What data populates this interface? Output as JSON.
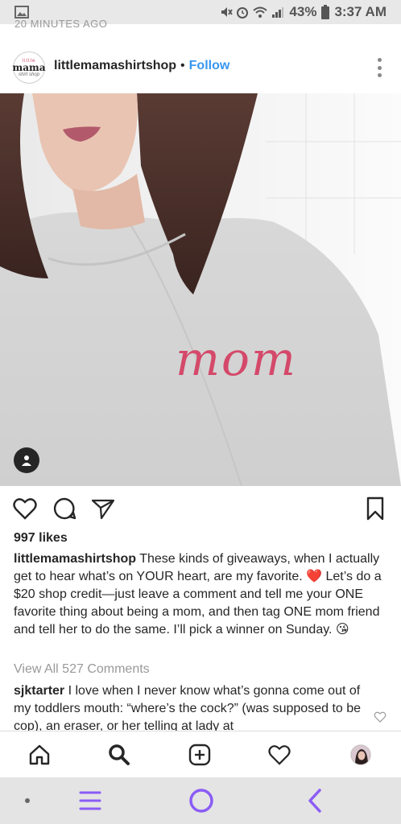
{
  "status_bar": {
    "battery": "43%",
    "time": "3:37 AM"
  },
  "post": {
    "time_partial": "20 MINUTES AGO",
    "logo_text": [
      "little",
      "mama",
      "shirt shop"
    ],
    "username": "littlemamashirtshop",
    "separator": "•",
    "follow_label": "Follow",
    "likes": "997 likes",
    "caption_user": "littlemamashirtshop",
    "caption_text": "These kinds of giveaways, when I actually get to hear what’s on YOUR heart, are my favorite. ❤️ Let’s do a $20 shop credit—just leave a comment and tell me your ONE favorite thing about being a mom, and then tag ONE mom friend and tell her to do the same. I’ll pick a winner on Sunday. 😘",
    "view_all": "View All 527 Comments",
    "comment_user": "sjktarter",
    "comment_text": "I love when I never know what’s gonna come out of my toddlers mouth: “where’s the cock?” (was supposed to be cop), an eraser, or her telling at lady at",
    "shirt_text": "mom"
  },
  "icons": {
    "like": "heart-icon",
    "comment": "comment-icon",
    "share": "send-icon",
    "save": "bookmark-icon",
    "tag": "user-tag-icon"
  },
  "colors": {
    "follow": "#3897f0",
    "nav_accent": "#8b5cf6",
    "shirt_text": "#d4496a"
  }
}
